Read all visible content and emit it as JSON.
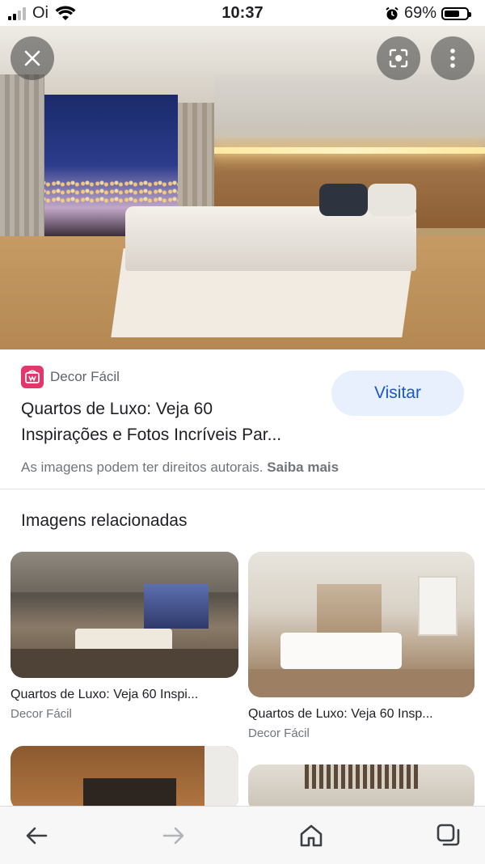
{
  "status_bar": {
    "carrier": "Oi",
    "time": "10:37",
    "battery_percent": "69%",
    "battery_level": 0.69
  },
  "hero": {
    "close_icon": "close-icon",
    "lens_icon": "lens-icon",
    "more_icon": "more-vertical-icon"
  },
  "source": {
    "site_name": "Decor Fácil",
    "title_line1": "Quartos de Luxo: Veja 60",
    "title_line2": "Inspirações e Fotos Incríveis Par...",
    "visit_label": "Visitar",
    "rights_text": "As imagens podem ter direitos autorais.",
    "learn_more": "Saiba mais"
  },
  "related": {
    "heading": "Imagens relacionadas",
    "items": [
      {
        "title": "Quartos de Luxo: Veja 60 Inspi...",
        "site": "Decor Fácil"
      },
      {
        "title": "Quartos de Luxo: Veja 60 Insp...",
        "site": "Decor Fácil"
      }
    ]
  },
  "colors": {
    "accent": "#1a57c9",
    "visit_bg": "#e8f0fe",
    "favicon": "#e3366b"
  }
}
